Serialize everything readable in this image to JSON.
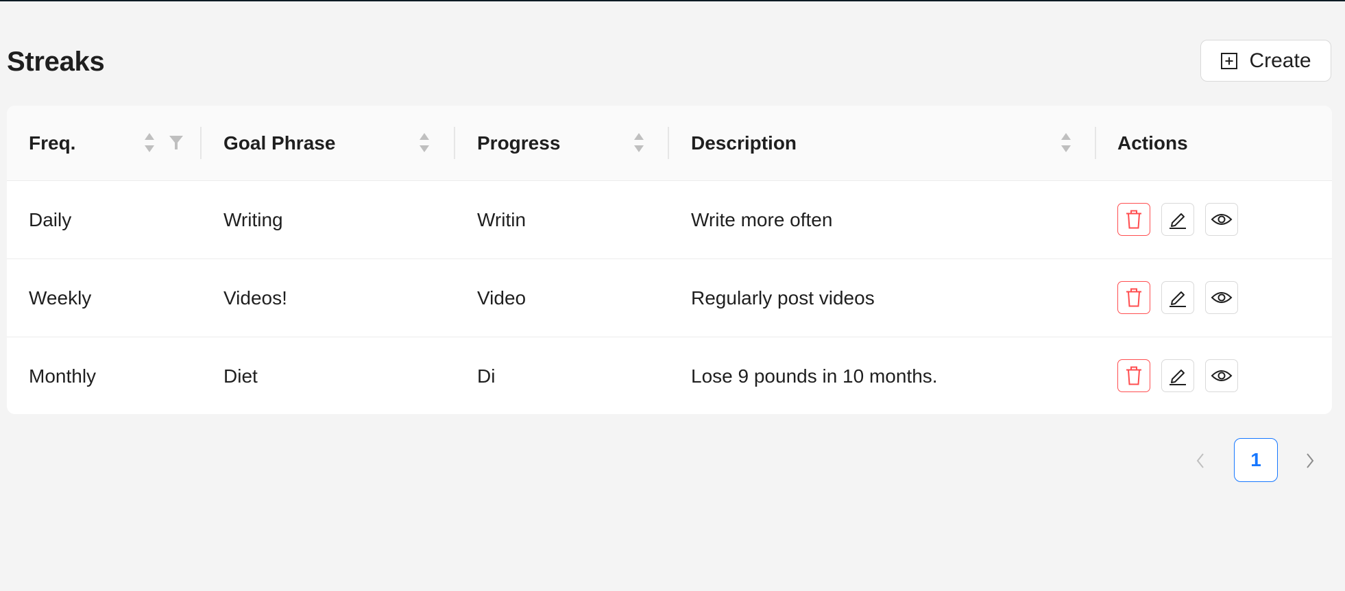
{
  "page": {
    "title": "Streaks",
    "create_label": "Create"
  },
  "table": {
    "columns": [
      {
        "label": "Freq.",
        "sortable": true,
        "filterable": true
      },
      {
        "label": "Goal Phrase",
        "sortable": true
      },
      {
        "label": "Progress",
        "sortable": true
      },
      {
        "label": "Description",
        "sortable": true
      },
      {
        "label": "Actions"
      }
    ],
    "rows": [
      {
        "freq": "Daily",
        "goal_phrase": "Writing",
        "progress": "Writin",
        "description": "Write more often"
      },
      {
        "freq": "Weekly",
        "goal_phrase": "Videos!",
        "progress": "Video",
        "description": "Regularly post videos"
      },
      {
        "freq": "Monthly",
        "goal_phrase": "Diet",
        "progress": "Di",
        "description": "Lose 9 pounds in 10 months."
      }
    ],
    "row_actions": [
      "trash-icon",
      "edit-icon",
      "eye-icon"
    ]
  },
  "pagination": {
    "current_page": "1"
  },
  "colors": {
    "background": "#f4f4f4",
    "primary": "#1677ff",
    "danger": "#ff4d4f",
    "border": "#d9d9d9"
  }
}
